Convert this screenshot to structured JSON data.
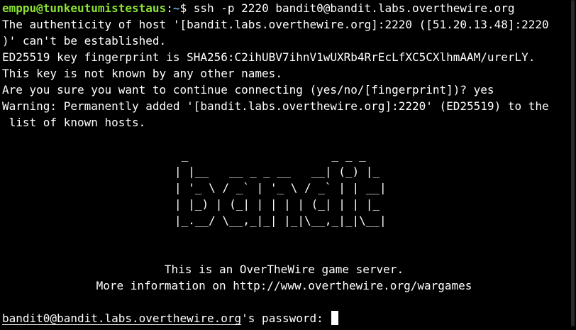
{
  "terminal": {
    "prompt": {
      "user_host": "emppu@tunkeutumistestaus",
      "separator": ":",
      "path": "~",
      "symbol": "$ ",
      "command": "ssh -p 2220 bandit0@bandit.labs.overthewire.org"
    },
    "lines": [
      "The authenticity of host '[bandit.labs.overthewire.org]:2220 ([51.20.13.48]:2220",
      ")' can't be established.",
      "ED25519 key fingerprint is SHA256:C2ihUBV7ihnV1wUXRb4RrEcLfXC5CXlhmAAM/urerLY.",
      "This key is not known by any other names.",
      "Are you sure you want to continue connecting (yes/no/[fingerprint])? yes",
      "Warning: Permanently added '[bandit.labs.overthewire.org]:2220' (ED25519) to the",
      " list of known hosts."
    ],
    "banner": [
      " _                     _ _ _   ",
      "| |__   __ _ _ __   __| (_) |_ ",
      "| '_ \\ / _` | '_ \\ / _` | | __|",
      "| |_) | (_| | | | | (_| | | |_ ",
      "|_.__/ \\__,_|_| |_|\\__,_|_|\\__|"
    ],
    "info_line_1": "This is an OverTheWire game server.",
    "info_line_2": "More information on http://www.overthewire.org/wargames",
    "password_prompt": {
      "host": "bandit0@bandit.labs.overthewire.org",
      "suffix": "'s password: "
    }
  }
}
